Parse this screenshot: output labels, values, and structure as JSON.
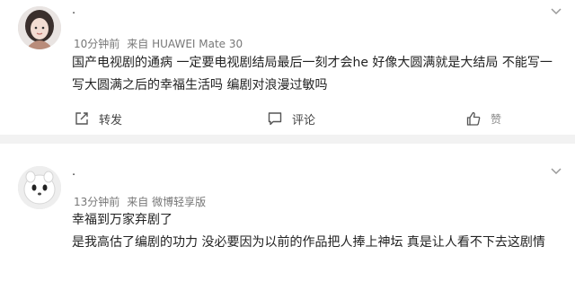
{
  "comments": [
    {
      "username": "·",
      "meta": {
        "time": "10分钟前",
        "source": "来自 HUAWEI Mate 30"
      },
      "lines": [
        "国产电视剧的通病 一定要电视剧结局最后一刻才会he 好像大圆满就是大结局 不能写一",
        "写大圆满之后的幸福生活吗 编剧对浪漫过敏吗"
      ],
      "actions": {
        "repost": "转发",
        "comment": "评论",
        "like": "赞"
      }
    },
    {
      "username": "·",
      "meta": {
        "time": "13分钟前",
        "source": "来自 微博轻享版"
      },
      "lines": [
        "幸福到万家弃剧了",
        "是我高估了编剧的功力 没必要因为以前的作品把人捧上神坛 真是让人看不下去这剧情"
      ]
    }
  ],
  "icons": {
    "repost": "repost-icon",
    "comment": "comment-icon",
    "like": "thumbs-up-icon",
    "more": "chevron-down-icon"
  },
  "colors": {
    "background": "#f2f2f2",
    "card": "#ffffff",
    "meta_text": "#777777",
    "body_text": "#222222"
  }
}
